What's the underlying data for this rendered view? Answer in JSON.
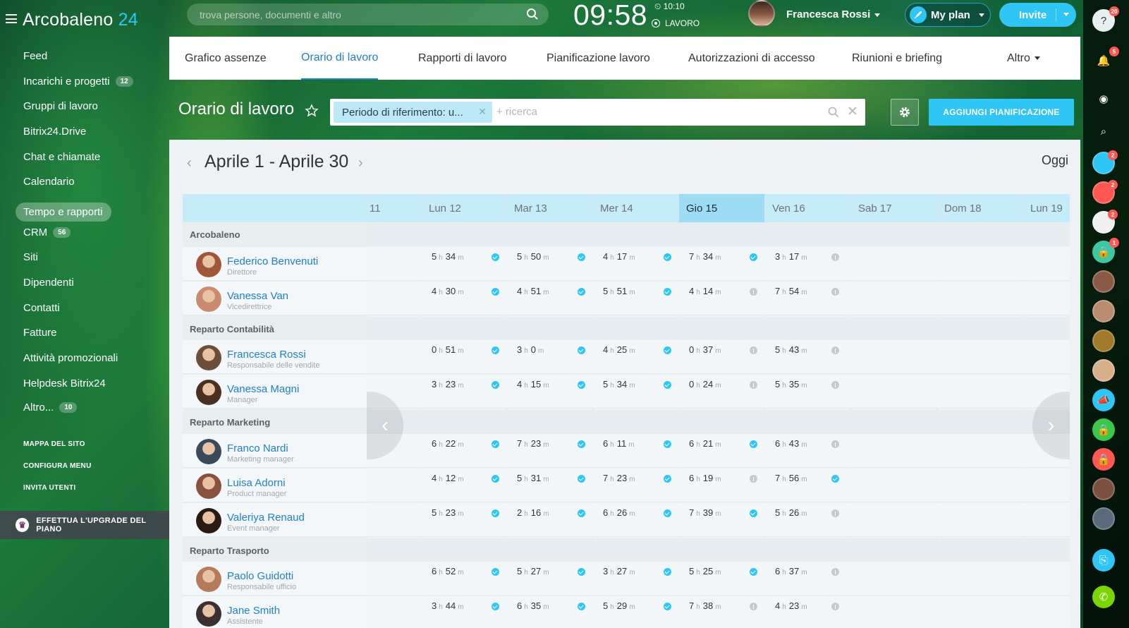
{
  "app": {
    "logo_prefix": "Arcobaleno ",
    "logo_suffix": "24"
  },
  "header": {
    "search_placeholder": "trova persone, documenti e altro",
    "clock": "09:58",
    "alarm": "⏲ 10:10",
    "work_status": "LAVORO",
    "user_name": "Francesca Rossi",
    "my_plan": "My plan",
    "invite": "Invite"
  },
  "sidebar": {
    "items": [
      {
        "label": "Feed"
      },
      {
        "label": "Incarichi e progetti",
        "count": "12"
      },
      {
        "label": "Gruppi di lavoro"
      },
      {
        "label": "Bitrix24.Drive"
      },
      {
        "label": "Chat e chiamate"
      },
      {
        "label": "Calendario"
      },
      {
        "label": "Tempo e rapporti",
        "active": true
      },
      {
        "label": "CRM",
        "count": "56"
      },
      {
        "label": "Siti"
      },
      {
        "label": "Dipendenti"
      },
      {
        "label": "Contatti"
      },
      {
        "label": "Fatture"
      },
      {
        "label": "Attività promozionali"
      },
      {
        "label": "Helpdesk Bitrix24"
      },
      {
        "label": "Altro...",
        "count": "10"
      }
    ],
    "links": [
      "MAPPA DEL SITO",
      "CONFIGURA MENU",
      "INVITA UTENTI"
    ],
    "upgrade": "EFFETTUA L'UPGRADE DEL PIANO"
  },
  "rightbar": {
    "badges": {
      "help": "20",
      "notifications": "5",
      "a1": "2",
      "a2": "2",
      "a3": "2",
      "a4": "1"
    }
  },
  "tabs": [
    {
      "label": "Grafico assenze"
    },
    {
      "label": "Orario di lavoro",
      "active": true
    },
    {
      "label": "Rapporti di lavoro"
    },
    {
      "label": "Pianificazione lavoro"
    },
    {
      "label": "Autorizzazioni di accesso"
    },
    {
      "label": "Riunioni e briefing"
    },
    {
      "label": "Altro"
    }
  ],
  "page": {
    "title": "Orario di lavoro",
    "filter_chip": "Periodo di riferimento: u...",
    "filter_placeholder": "+ ricerca",
    "add_button": "AGGIUNGI PIANIFICAZIONE"
  },
  "calendar": {
    "range": "Aprile 1 - Aprile 30",
    "today_label": "Oggi",
    "days": [
      "11",
      "Lun 12",
      "Mar 13",
      "Mer 14",
      "Gio 15",
      "Ven 16",
      "Sab 17",
      "Dom 18",
      "Lun 19"
    ],
    "today_index": 4,
    "unit_h": "h",
    "unit_m": "m",
    "groups": [
      {
        "name": "Arcobaleno",
        "employees": [
          {
            "name": "Federico Benvenuti",
            "role": "Direttore",
            "cells": [
              [
                "5",
                "34",
                1
              ],
              [
                "5",
                "50",
                1
              ],
              [
                "4",
                "17",
                1
              ],
              [
                "7",
                "34",
                1
              ],
              [
                "3",
                "17",
                0
              ]
            ]
          },
          {
            "name": "Vanessa Van",
            "role": "Vicedirettrice",
            "cells": [
              [
                "4",
                "30",
                1
              ],
              [
                "4",
                "51",
                1
              ],
              [
                "5",
                "51",
                1
              ],
              [
                "4",
                "14",
                0
              ],
              [
                "7",
                "54",
                0
              ]
            ]
          }
        ]
      },
      {
        "name": "Reparto Contabilità",
        "employees": [
          {
            "name": "Francesca Rossi",
            "role": "Responsabile delle vendite",
            "cells": [
              [
                "0",
                "51",
                1
              ],
              [
                "3",
                "0",
                1
              ],
              [
                "4",
                "25",
                1
              ],
              [
                "0",
                "37",
                0
              ],
              [
                "5",
                "43",
                0
              ]
            ]
          },
          {
            "name": "Vanessa Magni",
            "role": "Manager",
            "cells": [
              [
                "3",
                "23",
                1
              ],
              [
                "4",
                "15",
                1
              ],
              [
                "5",
                "34",
                1
              ],
              [
                "0",
                "24",
                0
              ],
              [
                "5",
                "35",
                0
              ]
            ]
          }
        ]
      },
      {
        "name": "Reparto Marketing",
        "employees": [
          {
            "name": "Franco Nardi",
            "role": "Marketing manager",
            "cells": [
              [
                "6",
                "22",
                1
              ],
              [
                "7",
                "23",
                1
              ],
              [
                "6",
                "11",
                1
              ],
              [
                "6",
                "21",
                1
              ],
              [
                "6",
                "43",
                0
              ]
            ]
          },
          {
            "name": "Luisa Adorni",
            "role": "Product manager",
            "cells": [
              [
                "4",
                "12",
                1
              ],
              [
                "5",
                "31",
                1
              ],
              [
                "7",
                "23",
                1
              ],
              [
                "6",
                "19",
                0
              ],
              [
                "7",
                "56",
                1
              ]
            ]
          },
          {
            "name": "Valeriya Renaud",
            "role": "Event manager",
            "cells": [
              [
                "5",
                "23",
                1
              ],
              [
                "2",
                "16",
                1
              ],
              [
                "6",
                "26",
                1
              ],
              [
                "7",
                "39",
                1
              ],
              [
                "5",
                "26",
                0
              ]
            ]
          }
        ]
      },
      {
        "name": "Reparto Trasporto",
        "employees": [
          {
            "name": "Paolo Guidotti",
            "role": "Responsabile ufficio",
            "cells": [
              [
                "6",
                "52",
                1
              ],
              [
                "5",
                "27",
                1
              ],
              [
                "3",
                "27",
                1
              ],
              [
                "5",
                "25",
                1
              ],
              [
                "6",
                "37",
                0
              ]
            ]
          },
          {
            "name": "Jane Smith",
            "role": "Assistente",
            "cells": [
              [
                "3",
                "44",
                1
              ],
              [
                "6",
                "35",
                1
              ],
              [
                "5",
                "29",
                1
              ],
              [
                "7",
                "38",
                0
              ],
              [
                "4",
                "23",
                0
              ]
            ]
          }
        ]
      }
    ]
  }
}
